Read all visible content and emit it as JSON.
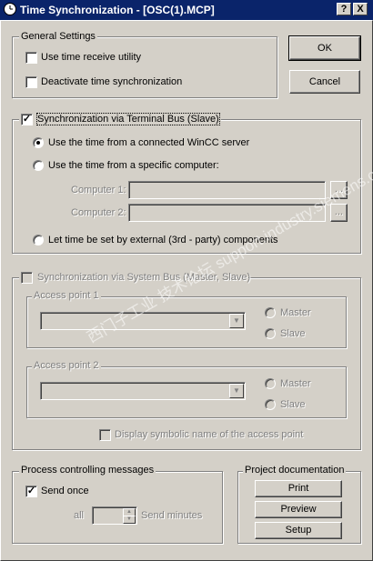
{
  "window": {
    "title": "Time Synchronization - [OSC(1).MCP]",
    "help_glyph": "?",
    "close_glyph": "X",
    "icon": "clock-icon"
  },
  "general": {
    "legend": "General Settings",
    "use_time_receive": {
      "label": "Use time receive utility",
      "checked": false
    },
    "deactivate_sync": {
      "label": "Deactivate time synchronization",
      "checked": false
    }
  },
  "buttons": {
    "ok": "OK",
    "cancel": "Cancel"
  },
  "terminal_bus": {
    "label": "Synchronization via Terminal Bus (Slave)",
    "checked": true,
    "check_glyph": "✓",
    "radio_wincc": "Use the time from a connected WinCC server",
    "radio_specific": "Use the time from a specific computer:",
    "computer1_label": "Computer 1:",
    "computer2_label": "Computer 2:",
    "browse_label": "...",
    "radio_external": "Let time be set by external (3rd - party) components",
    "selected": "wincc"
  },
  "system_bus": {
    "label": "Synchronization via System Bus (Master, Slave)",
    "access_point_1": {
      "legend": "Access point 1",
      "master": "Master",
      "slave": "Slave"
    },
    "access_point_2": {
      "legend": "Access point 2",
      "master": "Master",
      "slave": "Slave"
    },
    "display_symbolic": "Display symbolic name of the access point",
    "dropdown_glyph": "▼"
  },
  "process_messages": {
    "legend": "Process controlling messages",
    "send_once": {
      "label": "Send once",
      "checked": true
    },
    "all_label": "all",
    "send_minutes_label": "Send minutes",
    "spin_up": "▲",
    "spin_down": "▼"
  },
  "project_doc": {
    "legend": "Project documentation",
    "print": "Print",
    "preview": "Preview",
    "setup": "Setup"
  },
  "watermark": "西门子工业 技术论坛 support.industry.siemens.com/cs"
}
